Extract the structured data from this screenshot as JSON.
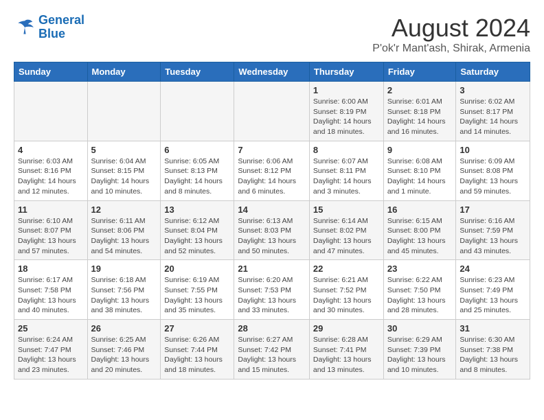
{
  "logo": {
    "line1": "General",
    "line2": "Blue"
  },
  "title": "August 2024",
  "subtitle": "P'ok'r Mant'ash, Shirak, Armenia",
  "days_of_week": [
    "Sunday",
    "Monday",
    "Tuesday",
    "Wednesday",
    "Thursday",
    "Friday",
    "Saturday"
  ],
  "weeks": [
    [
      {
        "day": "",
        "info": ""
      },
      {
        "day": "",
        "info": ""
      },
      {
        "day": "",
        "info": ""
      },
      {
        "day": "",
        "info": ""
      },
      {
        "day": "1",
        "info": "Sunrise: 6:00 AM\nSunset: 8:19 PM\nDaylight: 14 hours\nand 18 minutes."
      },
      {
        "day": "2",
        "info": "Sunrise: 6:01 AM\nSunset: 8:18 PM\nDaylight: 14 hours\nand 16 minutes."
      },
      {
        "day": "3",
        "info": "Sunrise: 6:02 AM\nSunset: 8:17 PM\nDaylight: 14 hours\nand 14 minutes."
      }
    ],
    [
      {
        "day": "4",
        "info": "Sunrise: 6:03 AM\nSunset: 8:16 PM\nDaylight: 14 hours\nand 12 minutes."
      },
      {
        "day": "5",
        "info": "Sunrise: 6:04 AM\nSunset: 8:15 PM\nDaylight: 14 hours\nand 10 minutes."
      },
      {
        "day": "6",
        "info": "Sunrise: 6:05 AM\nSunset: 8:13 PM\nDaylight: 14 hours\nand 8 minutes."
      },
      {
        "day": "7",
        "info": "Sunrise: 6:06 AM\nSunset: 8:12 PM\nDaylight: 14 hours\nand 6 minutes."
      },
      {
        "day": "8",
        "info": "Sunrise: 6:07 AM\nSunset: 8:11 PM\nDaylight: 14 hours\nand 3 minutes."
      },
      {
        "day": "9",
        "info": "Sunrise: 6:08 AM\nSunset: 8:10 PM\nDaylight: 14 hours\nand 1 minute."
      },
      {
        "day": "10",
        "info": "Sunrise: 6:09 AM\nSunset: 8:08 PM\nDaylight: 13 hours\nand 59 minutes."
      }
    ],
    [
      {
        "day": "11",
        "info": "Sunrise: 6:10 AM\nSunset: 8:07 PM\nDaylight: 13 hours\nand 57 minutes."
      },
      {
        "day": "12",
        "info": "Sunrise: 6:11 AM\nSunset: 8:06 PM\nDaylight: 13 hours\nand 54 minutes."
      },
      {
        "day": "13",
        "info": "Sunrise: 6:12 AM\nSunset: 8:04 PM\nDaylight: 13 hours\nand 52 minutes."
      },
      {
        "day": "14",
        "info": "Sunrise: 6:13 AM\nSunset: 8:03 PM\nDaylight: 13 hours\nand 50 minutes."
      },
      {
        "day": "15",
        "info": "Sunrise: 6:14 AM\nSunset: 8:02 PM\nDaylight: 13 hours\nand 47 minutes."
      },
      {
        "day": "16",
        "info": "Sunrise: 6:15 AM\nSunset: 8:00 PM\nDaylight: 13 hours\nand 45 minutes."
      },
      {
        "day": "17",
        "info": "Sunrise: 6:16 AM\nSunset: 7:59 PM\nDaylight: 13 hours\nand 43 minutes."
      }
    ],
    [
      {
        "day": "18",
        "info": "Sunrise: 6:17 AM\nSunset: 7:58 PM\nDaylight: 13 hours\nand 40 minutes."
      },
      {
        "day": "19",
        "info": "Sunrise: 6:18 AM\nSunset: 7:56 PM\nDaylight: 13 hours\nand 38 minutes."
      },
      {
        "day": "20",
        "info": "Sunrise: 6:19 AM\nSunset: 7:55 PM\nDaylight: 13 hours\nand 35 minutes."
      },
      {
        "day": "21",
        "info": "Sunrise: 6:20 AM\nSunset: 7:53 PM\nDaylight: 13 hours\nand 33 minutes."
      },
      {
        "day": "22",
        "info": "Sunrise: 6:21 AM\nSunset: 7:52 PM\nDaylight: 13 hours\nand 30 minutes."
      },
      {
        "day": "23",
        "info": "Sunrise: 6:22 AM\nSunset: 7:50 PM\nDaylight: 13 hours\nand 28 minutes."
      },
      {
        "day": "24",
        "info": "Sunrise: 6:23 AM\nSunset: 7:49 PM\nDaylight: 13 hours\nand 25 minutes."
      }
    ],
    [
      {
        "day": "25",
        "info": "Sunrise: 6:24 AM\nSunset: 7:47 PM\nDaylight: 13 hours\nand 23 minutes."
      },
      {
        "day": "26",
        "info": "Sunrise: 6:25 AM\nSunset: 7:46 PM\nDaylight: 13 hours\nand 20 minutes."
      },
      {
        "day": "27",
        "info": "Sunrise: 6:26 AM\nSunset: 7:44 PM\nDaylight: 13 hours\nand 18 minutes."
      },
      {
        "day": "28",
        "info": "Sunrise: 6:27 AM\nSunset: 7:42 PM\nDaylight: 13 hours\nand 15 minutes."
      },
      {
        "day": "29",
        "info": "Sunrise: 6:28 AM\nSunset: 7:41 PM\nDaylight: 13 hours\nand 13 minutes."
      },
      {
        "day": "30",
        "info": "Sunrise: 6:29 AM\nSunset: 7:39 PM\nDaylight: 13 hours\nand 10 minutes."
      },
      {
        "day": "31",
        "info": "Sunrise: 6:30 AM\nSunset: 7:38 PM\nDaylight: 13 hours\nand 8 minutes."
      }
    ]
  ]
}
